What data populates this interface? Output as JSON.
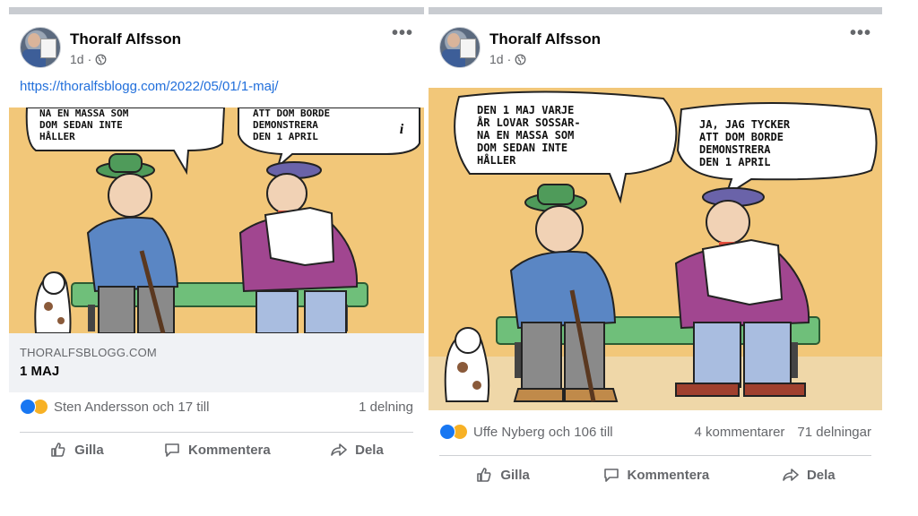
{
  "posts": [
    {
      "author": "Thoralf Alfsson",
      "time": "1d",
      "separator": "·",
      "more_glyph": "•••",
      "link_url": "https://thoralfsblogg.com/2022/05/01/1-maj/",
      "speech_left": "NA EN MASSA SOM\nDOM SEDAN INTE\nHÅLLER",
      "speech_right": "ATT DOM BORDE\nDEMONSTRERA\nDEN 1 APRIL",
      "info_glyph": "i",
      "preview_domain": "THORALFSBLOGG.COM",
      "preview_title": "1 MAJ",
      "reactions_text": "Sten Andersson och 17 till",
      "comments_text": "",
      "shares_text": "1 delning",
      "actions": {
        "like": "Gilla",
        "comment": "Kommentera",
        "share": "Dela"
      }
    },
    {
      "author": "Thoralf Alfsson",
      "time": "1d",
      "separator": "·",
      "more_glyph": "•••",
      "speech_left": "DEN 1 MAJ VARJE\nÅR LOVAR SOSSAR-\nNA EN MASSA SOM\nDOM SEDAN INTE\nHÅLLER",
      "speech_right": "JA, JAG TYCKER\nATT DOM BORDE\nDEMONSTRERA\nDEN 1 APRIL",
      "reactions_text": "Uffe Nyberg och 106 till",
      "comments_text": "4 kommentarer",
      "shares_text": "71 delningar",
      "actions": {
        "like": "Gilla",
        "comment": "Kommentera",
        "share": "Dela"
      }
    }
  ],
  "colors": {
    "link": "#216fdb",
    "secondary_text": "#65676b",
    "cartoon_bg": "#f2c779",
    "like_blue": "#1877f2",
    "haha_yellow": "#f7b125"
  },
  "icons": {
    "globe": "globe-icon",
    "like": "thumbs-up-icon",
    "comment": "speech-bubble-icon",
    "share": "share-arrow-icon",
    "more": "more-options-icon",
    "info": "info-icon"
  }
}
